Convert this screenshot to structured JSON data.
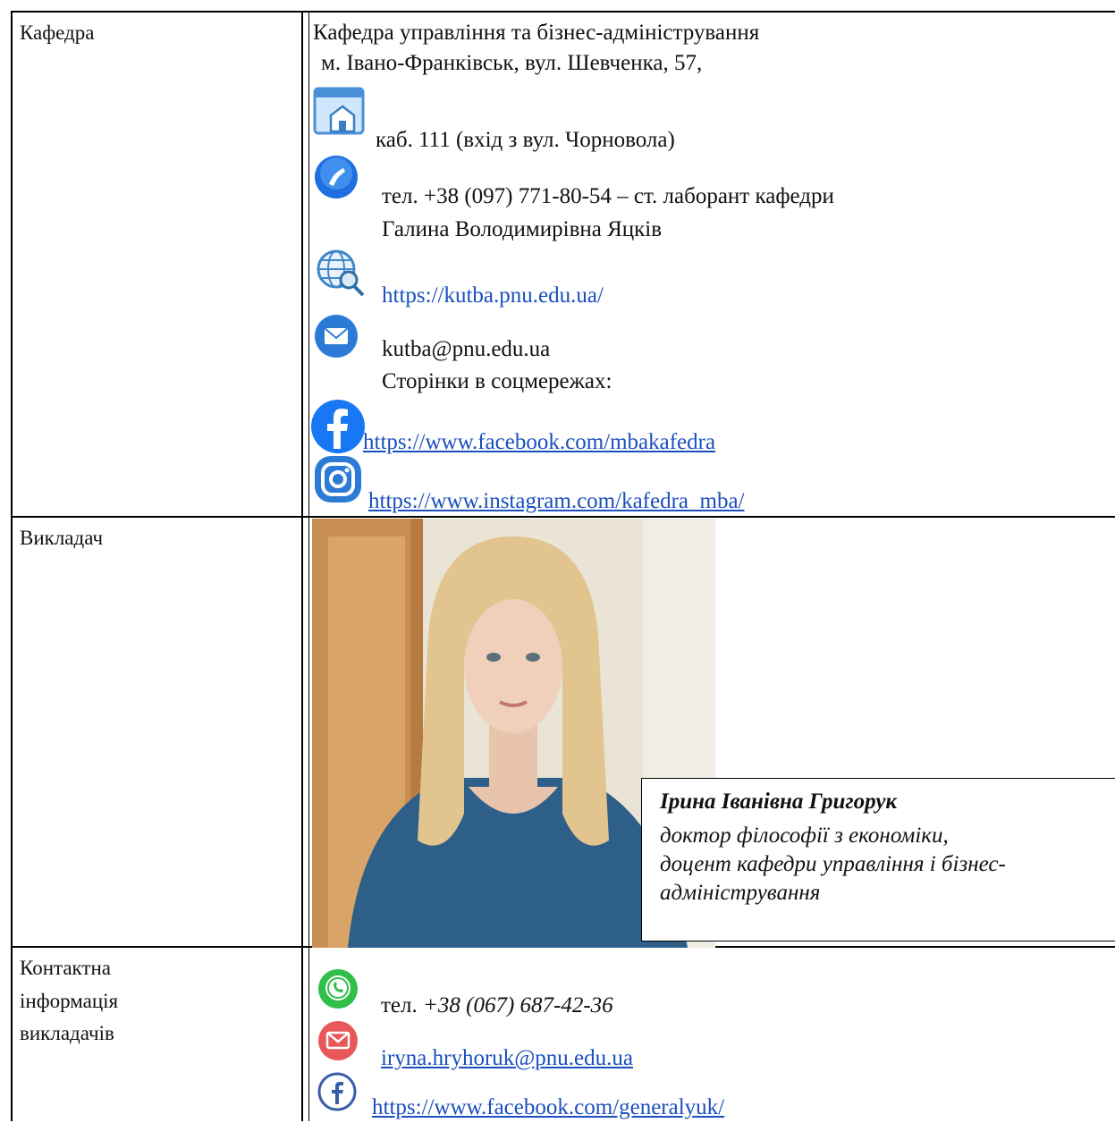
{
  "rows": {
    "department": {
      "label": "Кафедра",
      "name": "Кафедра управління та бізнес-адміністрування",
      "address": "м. Івано-Франківськ, вул. Шевченка, 57,",
      "room": "каб. 111 (вхід з вул. Чорновола)",
      "phone": "тел. +38 (097) 771-80-54 –  ст. лаборант кафедри",
      "phone_person": "Галина Володимирівна Яцків",
      "website": "https://kutba.pnu.edu.ua/",
      "email": "kutba@pnu.edu.ua",
      "social_heading": "Сторінки в соцмережах:",
      "facebook": "https://www.facebook.com/mbakafedra",
      "instagram": "https://www.instagram.com/kafedra_mba/"
    },
    "teacher": {
      "label": "Викладач",
      "name": "Ірина Іванівна Григорук",
      "title_line1": "доктор філософії з економіки,",
      "title_line2": "доцент кафедри управління і бізнес-",
      "title_line3": "адміністрування"
    },
    "contacts": {
      "label_line1": "Контактна",
      "label_line2": "інформація",
      "label_line3": "викладачів",
      "phone_prefix": "тел.",
      "phone_number": "+38 (067) 687-42-36",
      "email": "iryna.hryhoruk@pnu.edu.ua",
      "facebook": "https://www.facebook.com/generalyuk/"
    }
  },
  "icons": {
    "room": "building-home-icon",
    "phone": "phone-icon",
    "website": "globe-search-icon",
    "email": "envelope-icon",
    "facebook": "facebook-icon",
    "instagram": "instagram-icon",
    "whatsapp": "whatsapp-icon",
    "mail": "mail-icon",
    "facebook_outline": "facebook-outline-icon"
  },
  "colors": {
    "link": "#1a4fbd",
    "facebook": "#1877f2",
    "whatsapp": "#2fbf4a",
    "mail": "#e8585a"
  }
}
